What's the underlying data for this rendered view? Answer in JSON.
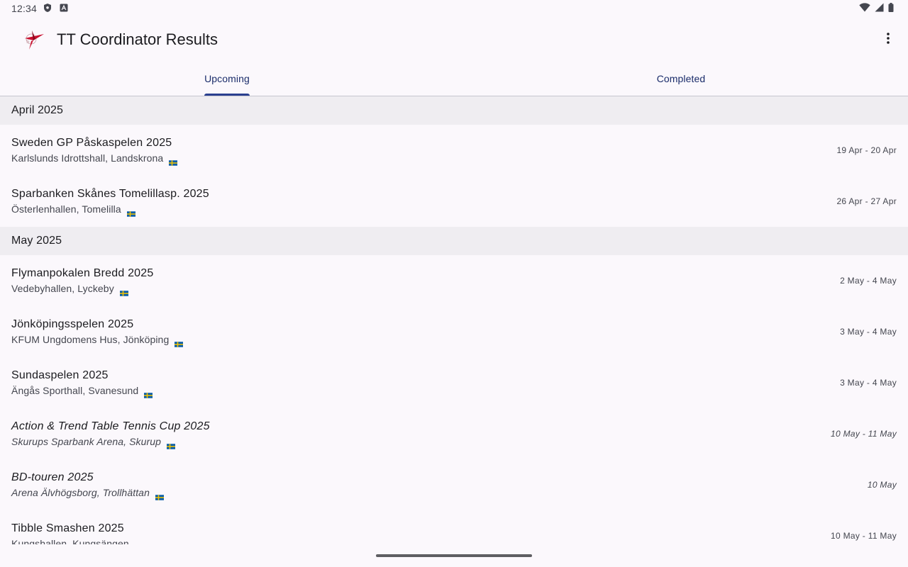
{
  "status_bar": {
    "time": "12:34",
    "left_icons": [
      "shield-icon",
      "a-box-icon"
    ],
    "right_icons": [
      "wifi-icon",
      "signal-icon",
      "battery-icon"
    ]
  },
  "app_bar": {
    "title": "TT Coordinator Results",
    "logo": "app-logo-icon",
    "overflow_icon": "more-vert-icon"
  },
  "tabs": [
    {
      "label": "Upcoming",
      "selected": true
    },
    {
      "label": "Completed",
      "selected": false
    }
  ],
  "colors": {
    "accent": "#2a3f8f",
    "tab_text": "#1a2c6a",
    "header_bg": "#efedf1",
    "background": "#fbf8fc",
    "flag_blue": "#0a5ea8",
    "flag_yellow": "#f7c600"
  },
  "sections": [
    {
      "month": "April 2025",
      "events": [
        {
          "name": "Sweden GP Påskaspelen 2025",
          "venue": "Karlslunds Idrottshall, Landskrona",
          "dates": "19 Apr - 20 Apr",
          "italic": false,
          "flag": "sweden-flag-icon"
        },
        {
          "name": "Sparbanken Skånes Tomelillasp. 2025",
          "venue": "Österlenhallen, Tomelilla",
          "dates": "26 Apr - 27 Apr",
          "italic": false,
          "flag": "sweden-flag-icon"
        }
      ]
    },
    {
      "month": "May 2025",
      "events": [
        {
          "name": "Flymanpokalen Bredd 2025",
          "venue": "Vedebyhallen, Lyckeby",
          "dates": "2 May - 4 May",
          "italic": false,
          "flag": "sweden-flag-icon"
        },
        {
          "name": "Jönköpingsspelen 2025",
          "venue": "KFUM Ungdomens Hus, Jönköping",
          "dates": "3 May - 4 May",
          "italic": false,
          "flag": "sweden-flag-icon"
        },
        {
          "name": "Sundaspelen 2025",
          "venue": "Ängås Sporthall, Svanesund",
          "dates": "3 May - 4 May",
          "italic": false,
          "flag": "sweden-flag-icon"
        },
        {
          "name": "Action & Trend Table Tennis Cup 2025",
          "venue": "Skurups Sparbank Arena, Skurup",
          "dates": "10 May - 11 May",
          "italic": true,
          "flag": "sweden-flag-icon"
        },
        {
          "name": "BD-touren 2025",
          "venue": "Arena Älvhögsborg, Trollhättan",
          "dates": "10 May",
          "italic": true,
          "flag": "sweden-flag-icon"
        },
        {
          "name": "Tibble Smashen 2025",
          "venue": "Kungshallen, Kungsängen",
          "dates": "10 May - 11 May",
          "italic": false,
          "flag": "sweden-flag-icon"
        }
      ]
    }
  ]
}
